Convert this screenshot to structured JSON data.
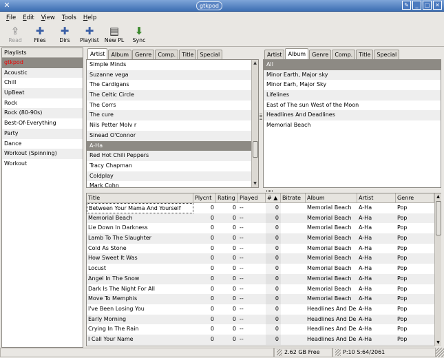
{
  "window": {
    "title": "gtkpod",
    "close_glyph": "✕",
    "btn_glyphs": [
      "✎",
      "_",
      "□",
      "✕"
    ]
  },
  "menu": [
    "File",
    "Edit",
    "View",
    "Tools",
    "Help"
  ],
  "toolbar": [
    {
      "label": "Read",
      "icon": "read-icon",
      "glyph": "⇪",
      "disabled": true
    },
    {
      "label": "Files",
      "icon": "add-files-icon",
      "glyph": "✚"
    },
    {
      "label": "Dirs",
      "icon": "add-dirs-icon",
      "glyph": "✚"
    },
    {
      "label": "Playlist",
      "icon": "add-playlist-icon",
      "glyph": "✚"
    },
    {
      "label": "New PL",
      "icon": "new-playlist-icon",
      "glyph": "▤"
    },
    {
      "label": "Sync",
      "icon": "sync-icon",
      "glyph": "⬇"
    }
  ],
  "playlists": {
    "header": "Playlists",
    "items": [
      "gtkpod",
      "Acoustic",
      "Chill",
      "UpBeat",
      "Rock",
      "Rock (80-90s)",
      "Best-Of-Everything",
      "Party",
      "Dance",
      "Workout (Spinning)",
      "Workout"
    ],
    "selected": 0
  },
  "left_pane": {
    "tabs": [
      "Artist",
      "Album",
      "Genre",
      "Comp.",
      "Title",
      "Special"
    ],
    "active_tab": 0,
    "items": [
      "Simple Minds",
      "Suzanne vega",
      "The Cardigans",
      "The Celtic Circle",
      "The Corrs",
      "The cure",
      "Nils Petter Molv r",
      "Sinead O'Connor",
      "A-Ha",
      "Red Hot Chili Peppers",
      "Tracy Chapman",
      "Coldplay",
      "Mark Cohn"
    ],
    "selected": 8
  },
  "right_pane": {
    "tabs": [
      "Artist",
      "Album",
      "Genre",
      "Comp.",
      "Title",
      "Special"
    ],
    "active_tab": 1,
    "items": [
      "All",
      "Minor Earth, Major sky",
      "Minor Earh, Major Sky",
      "Lifelines",
      "East of The sun West of the Moon",
      "Headlines And Deadlines",
      "Memorial Beach"
    ],
    "selected": 0
  },
  "tracks": {
    "columns": [
      "Title",
      "Plycnt",
      "Rating",
      "Played",
      "# ▲",
      "Bitrate",
      "Album",
      "Artist",
      "Genre"
    ],
    "rows": [
      [
        "Between Your Mama And Yourself",
        "0",
        "0",
        "--",
        "0",
        "",
        "Memorial Beach",
        "A-Ha",
        "Pop"
      ],
      [
        "Memorial Beach",
        "0",
        "0",
        "--",
        "0",
        "",
        "Memorial Beach",
        "A-Ha",
        "Pop"
      ],
      [
        "Lie Down In Darkness",
        "0",
        "0",
        "--",
        "0",
        "",
        "Memorial Beach",
        "A-Ha",
        "Pop"
      ],
      [
        "Lamb To The Slaughter",
        "0",
        "0",
        "--",
        "0",
        "",
        "Memorial Beach",
        "A-Ha",
        "Pop"
      ],
      [
        "Cold As Stone",
        "0",
        "0",
        "--",
        "0",
        "",
        "Memorial Beach",
        "A-Ha",
        "Pop"
      ],
      [
        "How Sweet It Was",
        "0",
        "0",
        "--",
        "0",
        "",
        "Memorial Beach",
        "A-Ha",
        "Pop"
      ],
      [
        "Locust",
        "0",
        "0",
        "--",
        "0",
        "",
        "Memorial Beach",
        "A-Ha",
        "Pop"
      ],
      [
        "Angel In The Snow",
        "0",
        "0",
        "--",
        "0",
        "",
        "Memorial Beach",
        "A-Ha",
        "Pop"
      ],
      [
        "Dark Is The Night For All",
        "0",
        "0",
        "--",
        "0",
        "",
        "Memorial Beach",
        "A-Ha",
        "Pop"
      ],
      [
        "Move To Memphis",
        "0",
        "0",
        "--",
        "0",
        "",
        "Memorial Beach",
        "A-Ha",
        "Pop"
      ],
      [
        "I've Been Losing You",
        "0",
        "0",
        "--",
        "0",
        "",
        "Headlines And De",
        "A-Ha",
        "Pop"
      ],
      [
        "Early Morning",
        "0",
        "0",
        "--",
        "0",
        "",
        "Headlines And De",
        "A-Ha",
        "Pop"
      ],
      [
        "Crying In The Rain",
        "0",
        "0",
        "--",
        "0",
        "",
        "Headlines And De",
        "A-Ha",
        "Pop"
      ],
      [
        "I Call Your Name",
        "0",
        "0",
        "--",
        "0",
        "",
        "Headlines And De",
        "A-Ha",
        "Pop"
      ]
    ]
  },
  "status": {
    "free_space": "2.62 GB Free",
    "counts": "P:10 S:64/2061"
  },
  "colors": {
    "selection": "#8d8a84",
    "selected_playlist_text": "#e00000",
    "titlebar": "#3d6fb3"
  }
}
